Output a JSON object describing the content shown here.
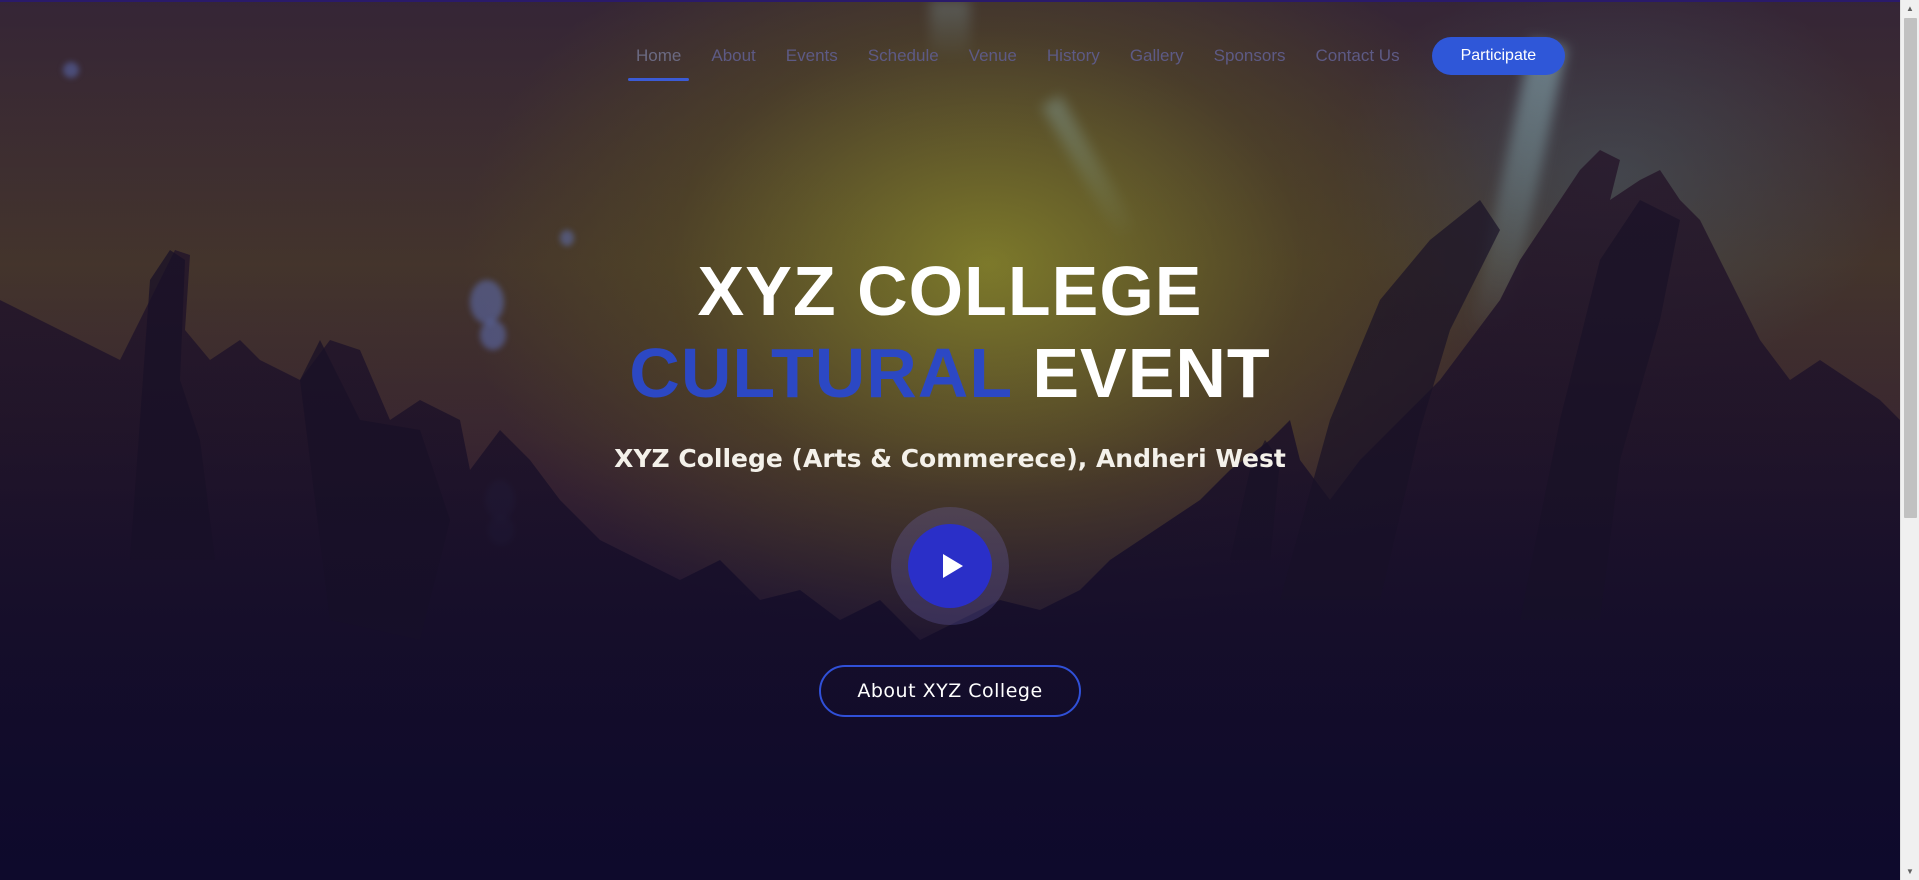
{
  "nav": {
    "items": [
      {
        "label": "Home",
        "active": true
      },
      {
        "label": "About"
      },
      {
        "label": "Events"
      },
      {
        "label": "Schedule"
      },
      {
        "label": "Venue"
      },
      {
        "label": "History"
      },
      {
        "label": "Gallery"
      },
      {
        "label": "Sponsors"
      },
      {
        "label": "Contact Us"
      }
    ],
    "cta_label": "Participate"
  },
  "hero": {
    "title_line1": "XYZ COLLEGE",
    "title_accent": "CULTURAL",
    "title_rest": "EVENT",
    "subtitle": "XYZ College (Arts & Commerece), Andheri West",
    "play_icon": "play-icon",
    "about_button_label": "About XYZ College"
  },
  "colors": {
    "accent": "#2f57d8",
    "title_accent": "#2c48c4",
    "play_button": "#2a2fc8"
  }
}
